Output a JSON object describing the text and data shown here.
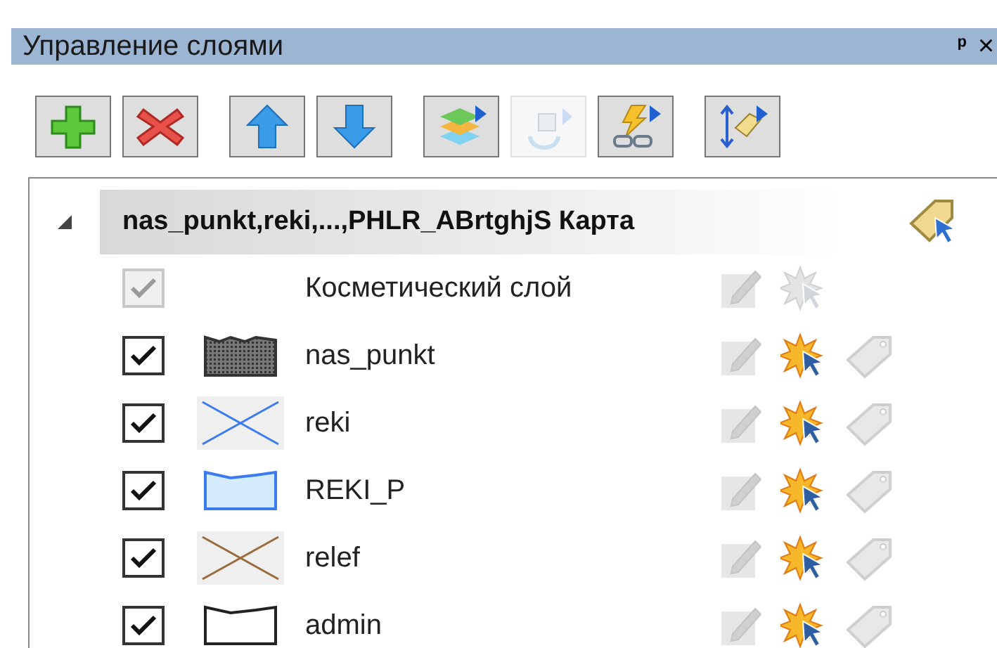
{
  "panel": {
    "title": "Управление слоями",
    "pin": "ᵖ",
    "close": "×"
  },
  "toolbar": [
    {
      "kind": "add",
      "disabled": false
    },
    {
      "kind": "remove",
      "disabled": false
    },
    {
      "kind": "up",
      "disabled": false
    },
    {
      "kind": "down",
      "disabled": false
    },
    {
      "kind": "layers",
      "disabled": false
    },
    {
      "kind": "export",
      "disabled": true
    },
    {
      "kind": "link",
      "disabled": false
    },
    {
      "kind": "tag",
      "disabled": false
    }
  ],
  "map": {
    "name": "nas_punkt,reki,...,PHLR_ABrtghjS Карта",
    "expanded": true,
    "layers": [
      {
        "name": "Косметический слой",
        "checked": true,
        "disabled": true,
        "kind": "none",
        "select_enabled": false,
        "has_tag": false
      },
      {
        "name": "nas_punkt",
        "checked": true,
        "disabled": false,
        "kind": "hatch",
        "color": "#333333",
        "select_enabled": true,
        "has_tag": true
      },
      {
        "name": "reki",
        "checked": true,
        "disabled": false,
        "kind": "line",
        "color": "#3a7bf0",
        "select_enabled": true,
        "has_tag": true
      },
      {
        "name": "REKI_P",
        "checked": true,
        "disabled": false,
        "kind": "polygon",
        "color": "#3a7bf0",
        "select_enabled": true,
        "has_tag": true
      },
      {
        "name": "relef",
        "checked": true,
        "disabled": false,
        "kind": "line",
        "color": "#9a6a3a",
        "select_enabled": true,
        "has_tag": true
      },
      {
        "name": "admin",
        "checked": true,
        "disabled": false,
        "kind": "outline",
        "color": "#222222",
        "select_enabled": true,
        "has_tag": true
      }
    ]
  }
}
